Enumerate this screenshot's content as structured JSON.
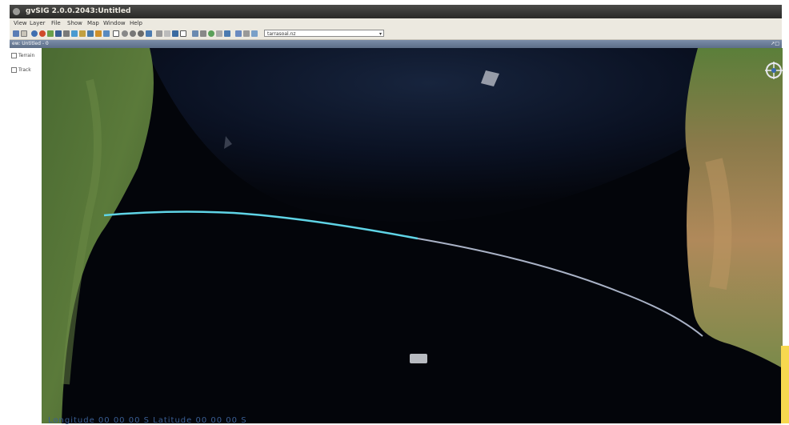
{
  "window": {
    "title": "gvSIG 2.0.0.2043:Untitled"
  },
  "menubar": {
    "items": [
      "View",
      "Layer",
      "File",
      "Show",
      "Map",
      "Window",
      "Help"
    ]
  },
  "toolbar": {
    "scale_value": "tarrasoal.nz"
  },
  "view": {
    "title": "ew: Untitled - 0",
    "corner_controls": "↗□"
  },
  "toc": {
    "items": [
      "Terrain",
      "Track"
    ]
  },
  "map": {
    "track_highlight_color": "#5fd4e6",
    "track_color": "#a9b2c6",
    "compass_color": "#e8e8f0"
  },
  "statusbar": {
    "coords": "Longitude 00 00 00 S  Latitude 00 00 00 S"
  }
}
